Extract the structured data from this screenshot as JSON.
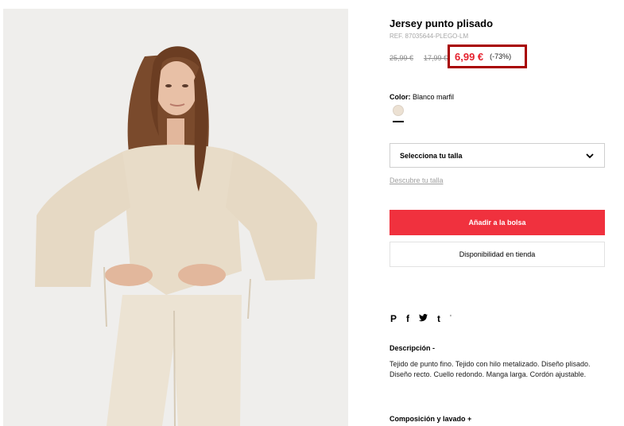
{
  "product": {
    "title": "Jersey punto plisado",
    "ref": "REF. 87035644-PLEGO-LM",
    "original_price": "25,99 €",
    "previous_price": "17,99 €",
    "price": "6,99 €",
    "discount": "(-73%)"
  },
  "color": {
    "label": "Color:",
    "value": "Blanco marfil",
    "swatch_hex": "#ece1d3"
  },
  "size": {
    "select_label": "Selecciona tu talla",
    "guide_link": "Descubre tu talla"
  },
  "actions": {
    "add_to_bag": "Añadir a la bolsa",
    "store_availability": "Disponibilidad en tienda"
  },
  "share": {
    "icons": [
      "pinterest-icon",
      "facebook-icon",
      "twitter-icon",
      "tumblr-icon"
    ],
    "pinterest": "P",
    "facebook": "f",
    "twitter": "🐦",
    "tumblr": "t",
    "more": "'"
  },
  "description": {
    "title": "Descripción -",
    "text": "Tejido de punto fino. Tejido con hilo metalizado. Diseño plisado. Diseño recto. Cuello redondo. Manga larga. Cordón ajustable."
  },
  "composition": {
    "title": "Composición y lavado +"
  },
  "colors": {
    "accent": "#f0313e",
    "price": "#e5212e",
    "highlight_border": "#a80000"
  }
}
